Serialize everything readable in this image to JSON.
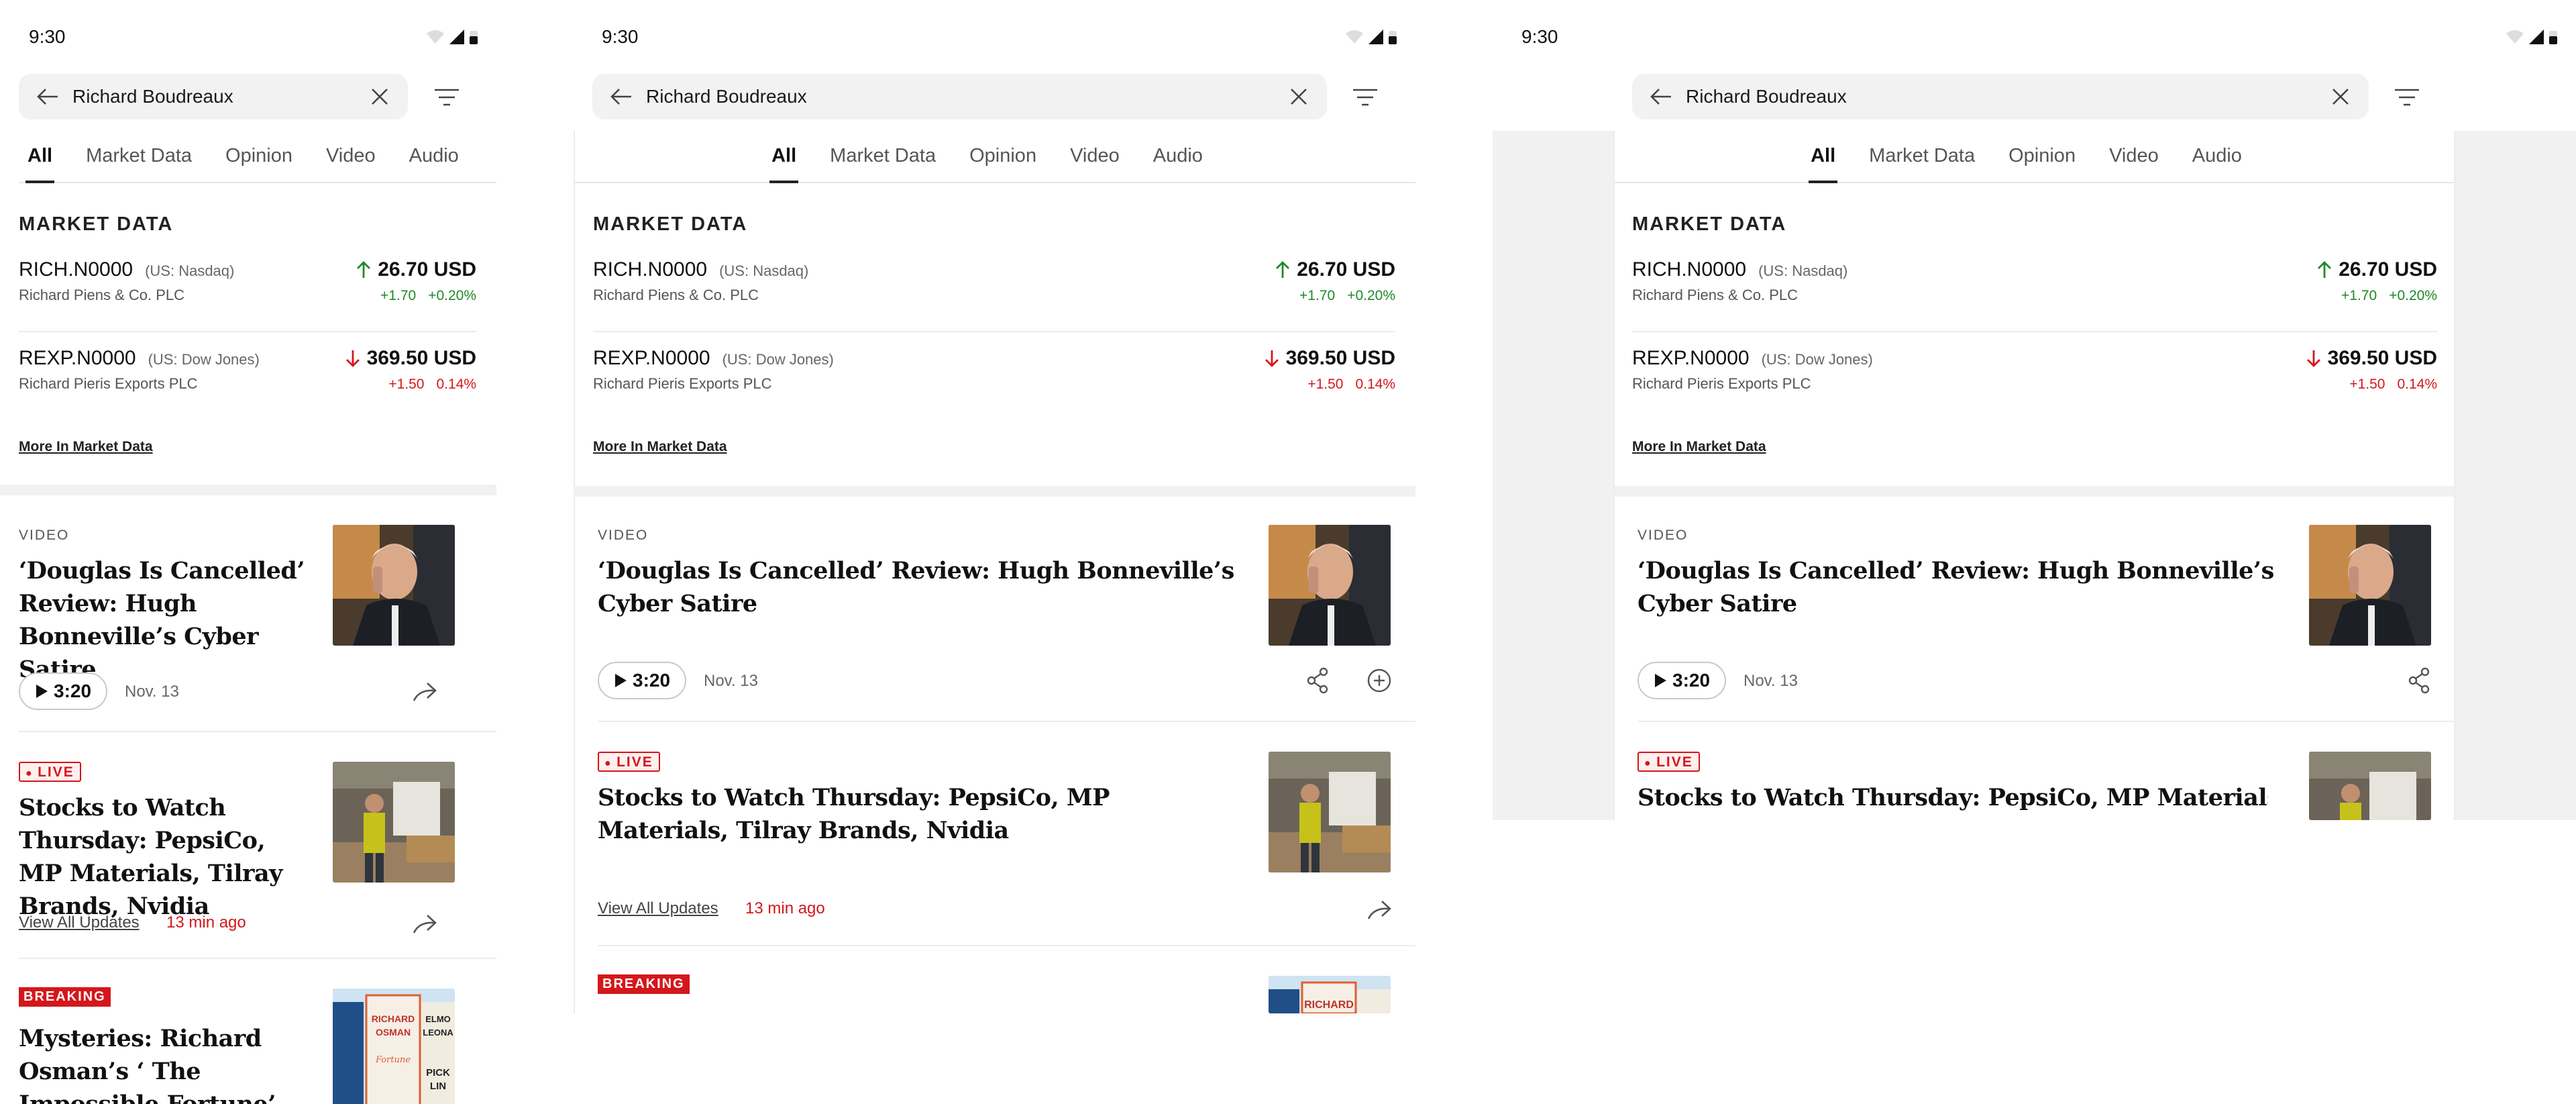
{
  "status": {
    "time": "9:30"
  },
  "search": {
    "query": "Richard Boudreaux"
  },
  "tabs": [
    "All",
    "Market Data",
    "Opinion",
    "Video",
    "Audio"
  ],
  "market": {
    "heading": "MARKET DATA",
    "quotes": [
      {
        "symbol": "RICH.N0000",
        "exchange": "(US: Nasdaq)",
        "company": "Richard Piens & Co. PLC",
        "price": "26.70 USD",
        "change": "+1.70",
        "percent": "+0.20%",
        "direction": "up"
      },
      {
        "symbol": "REXP.N0000",
        "exchange": "(US: Dow Jones)",
        "company": "Richard Pieris Exports PLC",
        "price": "369.50 USD",
        "change": "+1.50",
        "percent": "0.14%",
        "direction": "down"
      }
    ],
    "more_link": "More In Market Data"
  },
  "articles": {
    "video": {
      "kicker": "VIDEO",
      "headline": "‘Douglas Is Cancelled’ Review: Hugh Bonneville’s Cyber Satire",
      "duration": "3:20",
      "date": "Nov. 13"
    },
    "live": {
      "badge": "LIVE",
      "headline": "Stocks to Watch Thursday: PepsiCo, MP Materials, Tilray Brands, Nvidia",
      "view_all": "View All Updates",
      "ago": "13 min ago"
    },
    "breaking": {
      "badge": "BREAKING",
      "headline": "Mysteries: Richard Osman’s ‘ The Impossible Fortune’",
      "book_author": "RICHARD OSMAN",
      "book_title": "The Impossible Fortune",
      "book_other": "ELMO LEONA",
      "book_other2": "PICK LIN"
    }
  },
  "colors": {
    "up": "#1e8a24",
    "down": "#d4171b",
    "divider": "#f1f1f2"
  }
}
